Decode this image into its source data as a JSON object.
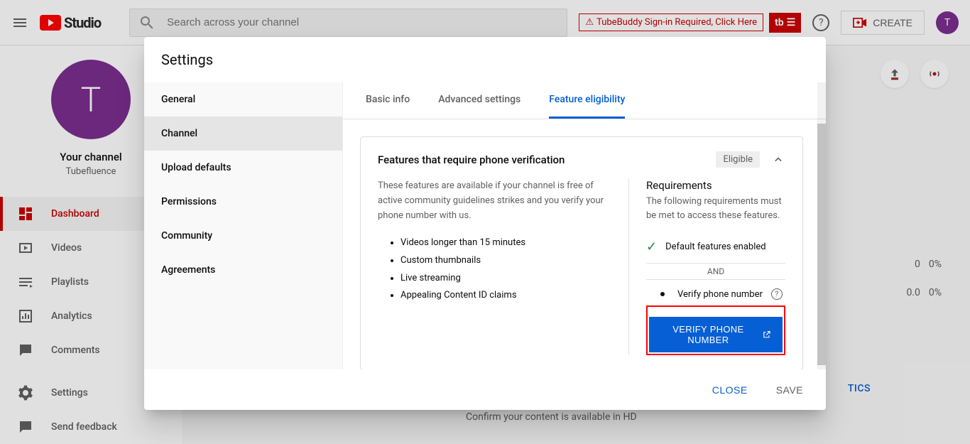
{
  "topbar": {
    "logo_text": "Studio",
    "search_placeholder": "Search across your channel",
    "tubebuddy_warning": "TubeBuddy Sign-in Required, Click Here",
    "tb_badge": "tb",
    "create_label": "CREATE",
    "avatar_letter": "T"
  },
  "sidebar": {
    "avatar_letter": "T",
    "channel_title": "Your channel",
    "channel_name": "Tubefluence",
    "items": [
      {
        "label": "Dashboard",
        "active": true
      },
      {
        "label": "Videos"
      },
      {
        "label": "Playlists"
      },
      {
        "label": "Analytics"
      },
      {
        "label": "Comments"
      }
    ],
    "bottom_items": [
      {
        "label": "Settings"
      },
      {
        "label": "Send feedback"
      }
    ]
  },
  "background": {
    "stats": [
      {
        "value": "0",
        "pct": "0%"
      },
      {
        "value": "0.0",
        "pct": "0%"
      }
    ],
    "link": "TICS",
    "confirm_text": "Confirm your content is available in HD"
  },
  "modal": {
    "title": "Settings",
    "nav": [
      {
        "label": "General"
      },
      {
        "label": "Channel",
        "active": true
      },
      {
        "label": "Upload defaults"
      },
      {
        "label": "Permissions"
      },
      {
        "label": "Community"
      },
      {
        "label": "Agreements"
      }
    ],
    "tabs": [
      {
        "label": "Basic info"
      },
      {
        "label": "Advanced settings"
      },
      {
        "label": "Feature eligibility",
        "active": true
      }
    ],
    "feature": {
      "title": "Features that require phone verification",
      "badge": "Eligible",
      "description": "These features are available if your channel is free of active community guidelines strikes and you verify your phone number with us.",
      "list": [
        "Videos longer than 15 minutes",
        "Custom thumbnails",
        "Live streaming",
        "Appealing Content ID claims"
      ],
      "requirements": {
        "title": "Requirements",
        "desc": "The following requirements must be met to access these features.",
        "item1": "Default features enabled",
        "and": "AND",
        "item2": "Verify phone number",
        "verify_btn": "VERIFY PHONE NUMBER"
      }
    },
    "footer": {
      "close": "CLOSE",
      "save": "SAVE"
    }
  }
}
